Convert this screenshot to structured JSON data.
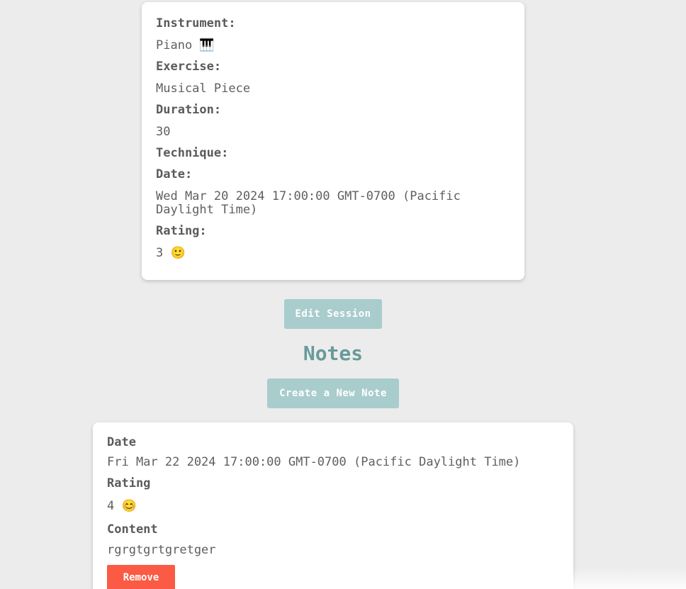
{
  "session": {
    "instrument_label": "Instrument:",
    "instrument_value": "Piano 🎹",
    "exercise_label": "Exercise:",
    "exercise_value": "Musical Piece",
    "duration_label": "Duration:",
    "duration_value": "30",
    "technique_label": "Technique:",
    "date_label": "Date:",
    "date_value": "Wed Mar 20 2024 17:00:00 GMT-0700 (Pacific Daylight Time)",
    "rating_label": "Rating:",
    "rating_value": "3 🙂"
  },
  "actions": {
    "edit_label": "Edit Session",
    "create_note_label": "Create a New Note"
  },
  "notes": {
    "title": "Notes",
    "items": [
      {
        "date_label": "Date",
        "date_value": "Fri Mar 22 2024 17:00:00 GMT-0700 (Pacific Daylight Time)",
        "rating_label": "Rating",
        "rating_value": "4 😊",
        "content_label": "Content",
        "content_value": "rgrgtgrtgretger",
        "remove_label": "Remove"
      }
    ]
  },
  "colors": {
    "background": "#ececec",
    "teal_button": "#a9cccc",
    "heading_teal": "#6a9a9a",
    "remove_red": "#fb5a44"
  }
}
